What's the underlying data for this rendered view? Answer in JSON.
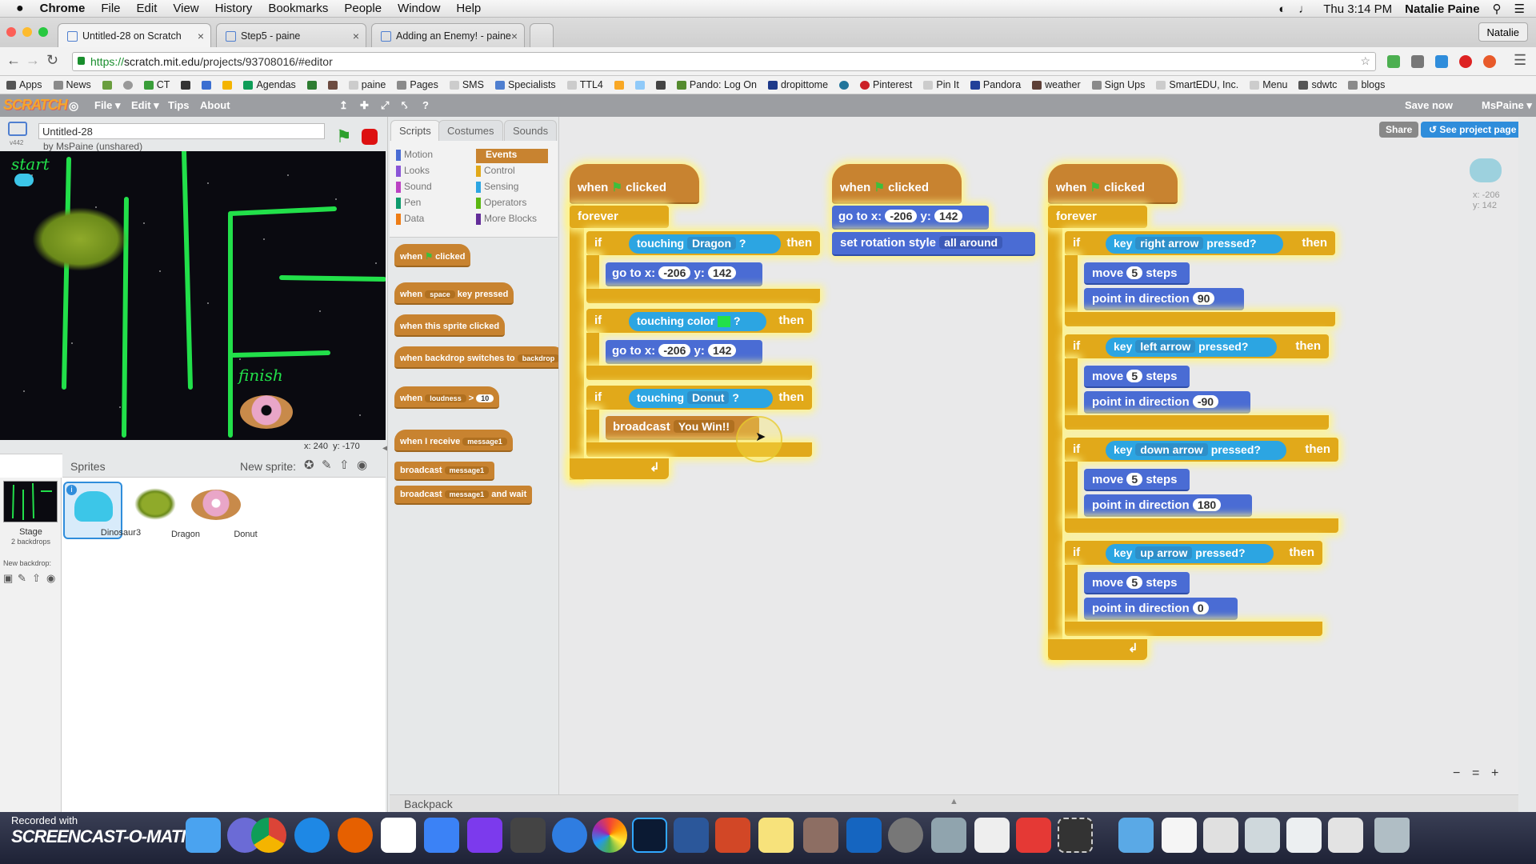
{
  "menubar": {
    "apple": "",
    "app": "Chrome",
    "items": [
      "File",
      "Edit",
      "View",
      "History",
      "Bookmarks",
      "People",
      "Window",
      "Help"
    ],
    "clock": "Thu 3:14 PM",
    "user": "Natalie Paine"
  },
  "tabs": [
    {
      "label": "Untitled-28 on Scratch",
      "close": "×"
    },
    {
      "label": "Step5 - paine",
      "close": "×"
    },
    {
      "label": "Adding an Enemy! - paine",
      "close": "×"
    }
  ],
  "profile_button": "Natalie",
  "address": {
    "secure": "https://",
    "url_host": "scratch.mit.edu",
    "url_rest": "/projects/93708016/#editor"
  },
  "bookmarks": [
    "Apps",
    "News",
    "",
    "",
    "CT",
    "",
    "",
    "",
    "Agendas",
    "",
    "",
    "paine",
    "Pages",
    "SMS",
    "Specialists",
    "TTL4",
    "",
    "",
    "",
    "Pando: Log On",
    "dropittome",
    "",
    "Pinterest",
    "Pin It",
    "Pandora",
    "weather",
    "Sign Ups",
    "SmartEDU, Inc.",
    "Menu",
    "sdwtc",
    "blogs"
  ],
  "scratch_bar": {
    "logo": "SCRATCH",
    "menus": [
      "File ▾",
      "Edit ▾",
      "Tips",
      "About"
    ],
    "save": "Save now",
    "account": "MsPaine ▾"
  },
  "project": {
    "title": "Untitled-28",
    "byline": "by MsPaine (unshared)",
    "version": "v442"
  },
  "stage": {
    "start_label": "start",
    "finish_label": "finish",
    "coords_x": "x: 240",
    "coords_y": "y: -170"
  },
  "sprites_header": {
    "title": "Sprites",
    "new_sprite": "New sprite:"
  },
  "stage_thumb": {
    "label": "Stage",
    "sub": "2 backdrops",
    "new_backdrop": "New backdrop:"
  },
  "sprites": [
    {
      "name": "Dinosaur3",
      "selected": true
    },
    {
      "name": "Dragon",
      "selected": false
    },
    {
      "name": "Donut",
      "selected": false
    }
  ],
  "editor_tabs": [
    "Scripts",
    "Costumes",
    "Sounds"
  ],
  "share_button": "Share",
  "project_page_button": "See project page",
  "categories": [
    {
      "name": "Motion",
      "color": "#4a6cd4"
    },
    {
      "name": "Events",
      "color": "#c88330",
      "selected": true
    },
    {
      "name": "Looks",
      "color": "#8a55d7"
    },
    {
      "name": "Control",
      "color": "#e1a91a"
    },
    {
      "name": "Sound",
      "color": "#bb42c3"
    },
    {
      "name": "Sensing",
      "color": "#2ca5e2"
    },
    {
      "name": "Pen",
      "color": "#0e9a6c"
    },
    {
      "name": "Operators",
      "color": "#5cb712"
    },
    {
      "name": "Data",
      "color": "#ee7d16"
    },
    {
      "name": "More Blocks",
      "color": "#632d99"
    }
  ],
  "palette_blocks": {
    "when_flag": "when",
    "clicked": "clicked",
    "key_pressed_a": "when",
    "key_pressed_key": "space",
    "key_pressed_b": "key pressed",
    "sprite_clicked": "when this sprite clicked",
    "backdrop_switch": "when backdrop switches to",
    "backdrop_val": "backdrop",
    "loudness_a": "when",
    "loudness_b": "loudness",
    "loudness_val": "10",
    "receive_a": "when I receive",
    "receive_val": "message1",
    "broadcast_a": "broadcast",
    "broadcast_val": "message1",
    "broadcast_wait_a": "broadcast",
    "broadcast_wait_val": "message1",
    "broadcast_wait_b": "and wait"
  },
  "script1": {
    "hat_a": "when",
    "hat_b": "clicked",
    "forever": "forever",
    "if1": "if",
    "touch1": "touching",
    "touch1_val": "Dragon",
    "q": "?",
    "then": "then",
    "goto1_a": "go to x:",
    "goto1_x": "-206",
    "goto1_b": "y:",
    "goto1_y": "142",
    "if2": "if",
    "touch2": "touching color",
    "then2": "then",
    "goto2_a": "go to x:",
    "goto2_x": "-206",
    "goto2_b": "y:",
    "goto2_y": "142",
    "if3": "if",
    "touch3": "touching",
    "touch3_val": "Donut",
    "then3": "then",
    "broadcast": "broadcast",
    "broadcast_val": "You Win!!",
    "loop_arrow": "↲"
  },
  "script2": {
    "hat_a": "when",
    "hat_b": "clicked",
    "goto_a": "go to x:",
    "goto_x": "-206",
    "goto_b": "y:",
    "goto_y": "142",
    "rot_a": "set rotation style",
    "rot_val": "all around"
  },
  "script3": {
    "hat_a": "when",
    "hat_b": "clicked",
    "forever": "forever",
    "blocks": [
      {
        "if": "if",
        "key": "key",
        "key_val": "right arrow",
        "pressed": "pressed?",
        "then": "then",
        "move": "move",
        "steps_val": "5",
        "steps": "steps",
        "point": "point in direction",
        "dir": "90"
      },
      {
        "if": "if",
        "key": "key",
        "key_val": "left arrow",
        "pressed": "pressed?",
        "then": "then",
        "move": "move",
        "steps_val": "5",
        "steps": "steps",
        "point": "point in direction",
        "dir": "-90"
      },
      {
        "if": "if",
        "key": "key",
        "key_val": "down arrow",
        "pressed": "pressed?",
        "then": "then",
        "move": "move",
        "steps_val": "5",
        "steps": "steps",
        "point": "point in direction",
        "dir": "180"
      },
      {
        "if": "if",
        "key": "key",
        "key_val": "up arrow",
        "pressed": "pressed?",
        "then": "then",
        "move": "move",
        "steps_val": "5",
        "steps": "steps",
        "point": "point in direction",
        "dir": "0"
      }
    ],
    "loop_arrow": "↲"
  },
  "sprite_info": {
    "x": "x: -206",
    "y": "y: 142"
  },
  "backpack": "Backpack",
  "zoom": {
    "out": "−",
    "reset": "=",
    "in": "+"
  },
  "watermark": {
    "line1": "Recorded with",
    "line2": "SCREENCAST-O-MATIC"
  },
  "colors": {
    "events": "#c88330",
    "control": "#e1a91a",
    "motion": "#4a6cd4",
    "sensing": "#2ca5e2",
    "maze_green": "#22e04a"
  }
}
